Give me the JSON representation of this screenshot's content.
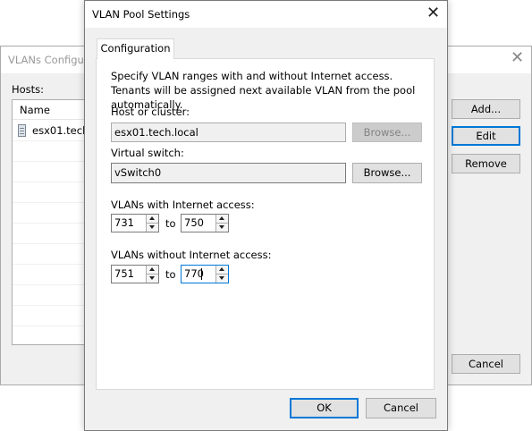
{
  "background_window": {
    "title": "VLANs Configur",
    "hosts_label": "Hosts:",
    "column_name": "Name",
    "rows": [
      "esx01.tech."
    ],
    "buttons": {
      "add": "Add...",
      "edit": "Edit",
      "remove": "Remove",
      "cancel": "Cancel"
    }
  },
  "dialog": {
    "title": "VLAN Pool Settings",
    "tab_label": "Configuration",
    "description": "Specify VLAN ranges with and without Internet access. Tenants will be assigned next available VLAN from the pool automatically.",
    "host_label": "Host or cluster:",
    "host_value": "esx01.tech.local",
    "host_browse": "Browse...",
    "switch_label": "Virtual switch:",
    "switch_value": "vSwitch0",
    "switch_browse": "Browse...",
    "with_internet_label": "VLANs with Internet access:",
    "with_from": "731",
    "with_to": "750",
    "without_internet_label": "VLANs without Internet access:",
    "without_from": "751",
    "without_to": "770",
    "to_label": "to",
    "ok": "OK",
    "cancel": "Cancel"
  },
  "icons": {
    "close": "close-icon",
    "server": "server-icon"
  },
  "colors": {
    "focus": "#0078d7",
    "window_bg": "#f0f0f0"
  }
}
